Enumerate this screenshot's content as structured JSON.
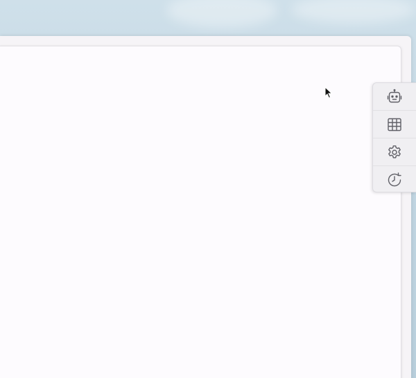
{
  "desktop": {
    "background": "sky-wallpaper"
  },
  "window": {
    "content_background": "#fdfbfe"
  },
  "side_toolbar": {
    "buttons": [
      {
        "id": "assistant",
        "icon": "robot-icon"
      },
      {
        "id": "table",
        "icon": "table-grid-icon"
      },
      {
        "id": "settings",
        "icon": "gear-icon"
      },
      {
        "id": "history",
        "icon": "history-clock-icon"
      }
    ],
    "icon_color": "#5f5f66"
  },
  "cursor": {
    "icon": "mouse-pointer-icon"
  }
}
